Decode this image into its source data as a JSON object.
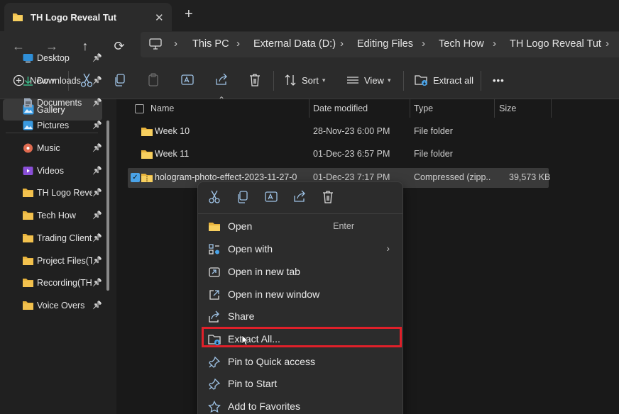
{
  "tab": {
    "title": "TH Logo Reveal Tut",
    "close": "✕",
    "new_tab": "+"
  },
  "nav": {
    "back": "←",
    "forward": "→",
    "up": "↑",
    "refresh": "⟳"
  },
  "breadcrumb": {
    "items": [
      "This PC",
      "External Data (D:)",
      "Editing Files",
      "Tech How",
      "TH Logo Reveal Tut"
    ],
    "separator": "›"
  },
  "toolbar": {
    "new_label": "New",
    "sort_label": "Sort",
    "view_label": "View",
    "extract_all_label": "Extract all",
    "more": "•••"
  },
  "sidebar": {
    "gallery": "Gallery",
    "items": [
      {
        "label": "Desktop",
        "icon": "desktop-icon",
        "color": "#2f8fd8"
      },
      {
        "label": "Downloads",
        "icon": "download-icon",
        "color": "#3dbb8a"
      },
      {
        "label": "Documents",
        "icon": "document-icon",
        "color": "#9aa7b8"
      },
      {
        "label": "Pictures",
        "icon": "picture-icon",
        "color": "#3a9ae0"
      },
      {
        "label": "Music",
        "icon": "music-icon",
        "color": "#e06b50"
      },
      {
        "label": "Videos",
        "icon": "video-icon",
        "color": "#8a4fd8"
      },
      {
        "label": "TH Logo Reveal",
        "icon": "folder-icon",
        "color": "#f2c14e"
      },
      {
        "label": "Tech How",
        "icon": "folder-icon",
        "color": "#f2c14e"
      },
      {
        "label": "Trading Client",
        "icon": "folder-icon",
        "color": "#f2c14e"
      },
      {
        "label": "Project Files(TH",
        "icon": "folder-icon",
        "color": "#f2c14e"
      },
      {
        "label": "Recording(TH)",
        "icon": "folder-icon",
        "color": "#f2c14e"
      },
      {
        "label": "Voice Overs",
        "icon": "folder-icon",
        "color": "#f2c14e"
      }
    ]
  },
  "columns": {
    "name": "Name",
    "date": "Date modified",
    "type": "Type",
    "size": "Size"
  },
  "files": [
    {
      "name": "Week 10",
      "date": "28-Nov-23 6:00 PM",
      "type": "File folder",
      "size": ""
    },
    {
      "name": "Week 11",
      "date": "01-Dec-23 6:57 PM",
      "type": "File folder",
      "size": ""
    },
    {
      "name": "hologram-photo-effect-2023-11-27-0",
      "date": "01-Dec-23 7:17 PM",
      "type": "Compressed (zipp...",
      "size": "39,573 KB"
    }
  ],
  "context_menu": {
    "items": [
      {
        "label": "Open",
        "shortcut": "Enter",
        "icon": "open-folder-icon"
      },
      {
        "label": "Open with",
        "submenu": "›",
        "icon": "open-with-icon"
      },
      {
        "label": "Open in new tab",
        "icon": "new-tab-icon"
      },
      {
        "label": "Open in new window",
        "icon": "new-window-icon"
      },
      {
        "label": "Share",
        "icon": "share-icon"
      },
      {
        "label": "Extract All...",
        "icon": "extract-icon"
      },
      {
        "label": "Pin to Quick access",
        "icon": "pin-icon"
      },
      {
        "label": "Pin to Start",
        "icon": "pin-icon"
      },
      {
        "label": "Add to Favorites",
        "icon": "star-icon"
      }
    ]
  },
  "colors": {
    "accent": "#4aa3e8",
    "folder": "#f2c14e",
    "highlight": "#e0202a"
  }
}
